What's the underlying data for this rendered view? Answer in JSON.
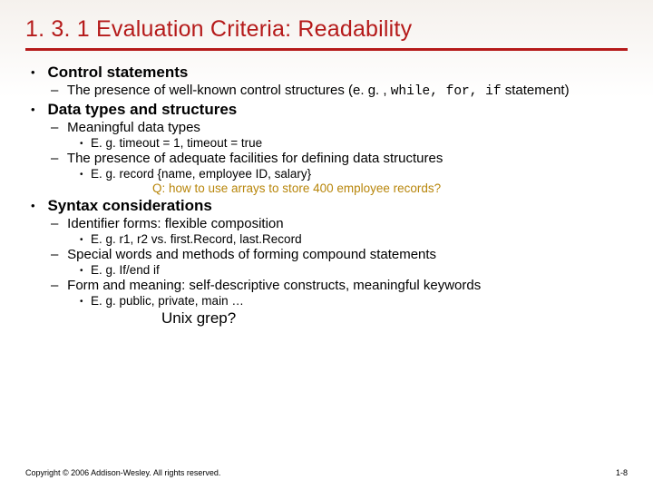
{
  "title": "1. 3. 1 Evaluation Criteria: Readability",
  "b1": {
    "head": "Control statements",
    "s1a": "The presence of well-known control structures (e. g. , ",
    "s1b": "while, for, if",
    "s1c": " statement)"
  },
  "b2": {
    "head": "Data types and structures",
    "s1": "Meaningful data types",
    "s1e": "E. g. timeout = 1, timeout = true",
    "s2": "The presence of adequate facilities for defining data structures",
    "s2e": "E. g. record {name, employee ID, salary}",
    "q": "Q: how to use arrays to store 400 employee records?"
  },
  "b3": {
    "head": "Syntax considerations",
    "s1": "Identifier forms: flexible composition",
    "s1e": "E. g. r1, r2 vs. first.Record, last.Record",
    "s2": "Special words and methods of forming compound statements",
    "s2e": "E. g. If/end if",
    "s3": "Form and meaning: self-descriptive constructs, meaningful keywords",
    "s3e": "E. g. public, private, main …",
    "grep": "Unix grep?"
  },
  "footer": {
    "copyright": "Copyright © 2006 Addison-Wesley. All rights reserved.",
    "page": "1-8"
  }
}
